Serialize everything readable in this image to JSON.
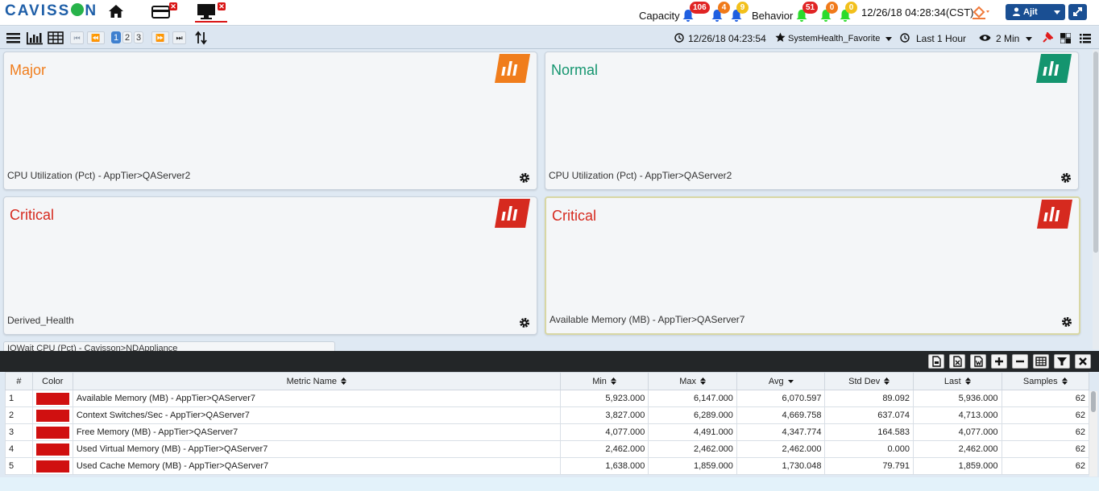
{
  "app": {
    "logo": "CAVISS",
    "logo_suffix": "N"
  },
  "header": {
    "capacity_label": "Capacity",
    "capacity_badges": [
      {
        "count": "106",
        "color": "#e02424"
      },
      {
        "count": "4",
        "color": "#f07a1a"
      },
      {
        "count": "9",
        "color": "#f2c01c"
      }
    ],
    "behavior_label": "Behavior",
    "behavior_badges": [
      {
        "count": "51",
        "color": "#e02424"
      },
      {
        "count": "0",
        "color": "#f07a1a"
      },
      {
        "count": "0",
        "color": "#f2c01c"
      }
    ],
    "datetime": "12/26/18 04:28:34(CST)",
    "user": "Ajit"
  },
  "toolbar": {
    "pages": [
      "1",
      "2",
      "3"
    ],
    "active_page": "1",
    "view_time": "12/26/18 04:23:54",
    "favorite": "SystemHealth_Favorite",
    "duration": "Last 1 Hour",
    "interval": "2 Min"
  },
  "widgets": [
    {
      "status": "Major",
      "status_color": "#f07d1c",
      "metric": "CPU Utilization (Pct) - AppTier>QAServer2",
      "badge_color": "#f07d1c"
    },
    {
      "status": "Normal",
      "status_color": "#14956f",
      "metric": "CPU Utilization (Pct) - AppTier>QAServer2",
      "badge_color": "#14956f"
    },
    {
      "status": "Critical",
      "status_color": "#d62a1f",
      "metric": "Derived_Health",
      "badge_color": "#d62a1f"
    },
    {
      "status": "Critical",
      "status_color": "#d62a1f",
      "metric": "Available Memory (MB) - AppTier>QAServer7",
      "badge_color": "#d62a1f"
    }
  ],
  "mini_widget": {
    "title": "IOWait CPU (Pct) - Cavisson>NDAppliance"
  },
  "table": {
    "columns": [
      "#",
      "Color",
      "Metric Name",
      "Min",
      "Max",
      "Avg",
      "Std Dev",
      "Last",
      "Samples"
    ],
    "rows": [
      {
        "n": "1",
        "color": "#d01010",
        "metric": "Available Memory (MB) - AppTier>QAServer7",
        "min": "5,923.000",
        "max": "6,147.000",
        "avg": "6,070.597",
        "std": "89.092",
        "last": "5,936.000",
        "samples": "62"
      },
      {
        "n": "2",
        "color": "#d01010",
        "metric": "Context Switches/Sec - AppTier>QAServer7",
        "min": "3,827.000",
        "max": "6,289.000",
        "avg": "4,669.758",
        "std": "637.074",
        "last": "4,713.000",
        "samples": "62"
      },
      {
        "n": "3",
        "color": "#d01010",
        "metric": "Free Memory (MB) - AppTier>QAServer7",
        "min": "4,077.000",
        "max": "4,491.000",
        "avg": "4,347.774",
        "std": "164.583",
        "last": "4,077.000",
        "samples": "62"
      },
      {
        "n": "4",
        "color": "#d01010",
        "metric": "Used Virtual Memory (MB) - AppTier>QAServer7",
        "min": "2,462.000",
        "max": "2,462.000",
        "avg": "2,462.000",
        "std": "0.000",
        "last": "2,462.000",
        "samples": "62"
      },
      {
        "n": "5",
        "color": "#d01010",
        "metric": "Used Cache Memory (MB) - AppTier>QAServer7",
        "min": "1,638.000",
        "max": "1,859.000",
        "avg": "1,730.048",
        "std": "79.791",
        "last": "1,859.000",
        "samples": "62"
      }
    ]
  }
}
